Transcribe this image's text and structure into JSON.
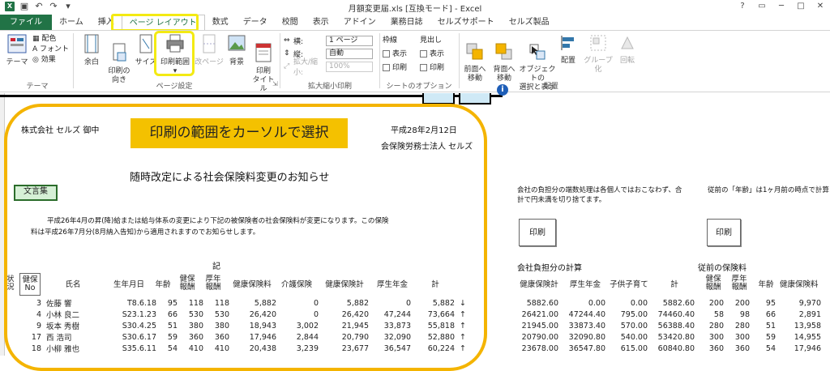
{
  "window": {
    "title": "月額変更届.xls  [互換モード] - Excel",
    "controls": [
      "?",
      "▭",
      "─",
      "□",
      "✕"
    ]
  },
  "tabs": [
    "ファイル",
    "ホーム",
    "挿入",
    "ページ レイアウト",
    "数式",
    "データ",
    "校閲",
    "表示",
    "アドイン",
    "業務日誌",
    "セルズサポート",
    "セルズ製品"
  ],
  "ribbon": {
    "theme": {
      "btn": "テーマ",
      "color": "配色",
      "font": "フォント",
      "effect": "効果",
      "group": "テーマ"
    },
    "page_setup": {
      "margin": "余白",
      "orientation": "印刷の\n向き",
      "size": "サイズ",
      "print_area": "印刷範囲",
      "breaks": "改ページ",
      "background": "背景",
      "print_titles": "印刷\nタイトル",
      "group": "ページ設定"
    },
    "scale": {
      "width_label": "横:",
      "width_value": "1 ページ",
      "height_label": "縦:",
      "height_value": "自動",
      "zoom_label": "拡大/縮小:",
      "zoom_value": "100%",
      "group": "拡大縮小印刷"
    },
    "sheet_opts": {
      "gridlines": "枠線",
      "headings": "見出し",
      "view": "表示",
      "print": "印刷",
      "group": "シートのオプション"
    },
    "arrange": {
      "forward": "前面へ\n移動",
      "backward": "背面へ\n移動",
      "selection": "オブジェクトの\n選択と表示",
      "align": "配置",
      "group_btn": "グループ化",
      "rotate": "回転",
      "group": "配置"
    }
  },
  "annotation": {
    "banner": "印刷の範囲をカーソルで選択"
  },
  "sheet": {
    "company_to": "株式会社 セルズ 御中",
    "date": "平成28年2月12日",
    "from": "会保険労務士法人 セルズ",
    "notice_title": "随時改定による社会保険料変更のお知らせ",
    "doc_button": "文言集",
    "body_line1": "平成26年4月の昇(降)給または給与体系の変更により下記の被保険者の社会保険料が変更になります。この保険",
    "body_line2": "料は平成26年7月分(8月納入告知)から適用されますのでお知らせします。",
    "ki": "記",
    "status_label": "状況",
    "right_note1": "会社の負担分の端数処理は各個人ではおこなわず、合",
    "right_note2": "計で円未満を切り捨てます。",
    "right_note3": "従前の「年齢」は1ヶ月前の時点で計算",
    "print_btn": "印刷",
    "company_calc": "会社負担分の計算",
    "prev_premium": "従前の保険料",
    "headers": {
      "kenpo_no": "健保\nNo",
      "name": "氏名",
      "birth": "生年月日",
      "age": "年齢",
      "kenpo_rem": "健保\n報酬",
      "kosei_rem": "厚年\n報酬",
      "health": "健康保険料",
      "care": "介護保険",
      "health_total": "健康保険計",
      "pension": "厚生年金",
      "total": "計"
    },
    "rows": [
      {
        "no": "3",
        "name": "佐藤 響",
        "birth": "T8.6.18",
        "age": "95",
        "k1": "118",
        "k2": "118",
        "health": "5,882",
        "care": "0",
        "ht": "5,882",
        "pension": "0",
        "total": "5,882",
        "arrow": "↓"
      },
      {
        "no": "4",
        "name": "小林 良二",
        "birth": "S23.1.23",
        "age": "66",
        "k1": "530",
        "k2": "530",
        "health": "26,420",
        "care": "0",
        "ht": "26,420",
        "pension": "47,244",
        "total": "73,664",
        "arrow": "↑"
      },
      {
        "no": "9",
        "name": "坂本 秀樹",
        "birth": "S30.4.25",
        "age": "51",
        "k1": "380",
        "k2": "380",
        "health": "18,943",
        "care": "3,002",
        "ht": "21,945",
        "pension": "33,873",
        "total": "55,818",
        "arrow": "↑"
      },
      {
        "no": "17",
        "name": "西 浩司",
        "birth": "S30.6.17",
        "age": "59",
        "k1": "360",
        "k2": "360",
        "health": "17,946",
        "care": "2,844",
        "ht": "20,790",
        "pension": "32,090",
        "total": "52,880",
        "arrow": "↑"
      },
      {
        "no": "18",
        "name": "小柳 雅也",
        "birth": "S35.6.11",
        "age": "54",
        "k1": "410",
        "k2": "410",
        "health": "20,438",
        "care": "3,239",
        "ht": "23,677",
        "pension": "36,547",
        "total": "60,224",
        "arrow": "↑"
      }
    ],
    "right_headers": {
      "health_total": "健康保険計",
      "pension": "厚生年金",
      "child": "子供子育て",
      "total": "計",
      "kenpo_rem": "健保\n報酬",
      "kosei_rem": "厚年\n報酬",
      "age": "年齢",
      "health": "健康保険料"
    },
    "right_rows": [
      {
        "ht": "5882.60",
        "pension": "0.00",
        "child": "0.00",
        "total": "5882.60",
        "k1": "200",
        "k2": "200",
        "age": "95",
        "health": "9,970"
      },
      {
        "ht": "26421.00",
        "pension": "47244.40",
        "child": "795.00",
        "total": "74460.40",
        "k1": "58",
        "k2": "98",
        "age": "66",
        "health": "2,891"
      },
      {
        "ht": "21945.00",
        "pension": "33873.40",
        "child": "570.00",
        "total": "56388.40",
        "k1": "280",
        "k2": "280",
        "age": "51",
        "health": "13,958"
      },
      {
        "ht": "20790.00",
        "pension": "32090.80",
        "child": "540.00",
        "total": "53420.80",
        "k1": "300",
        "k2": "300",
        "age": "59",
        "health": "14,955"
      },
      {
        "ht": "23678.00",
        "pension": "36547.80",
        "child": "615.00",
        "total": "60840.80",
        "k1": "360",
        "k2": "360",
        "age": "54",
        "health": "17,946"
      }
    ]
  }
}
